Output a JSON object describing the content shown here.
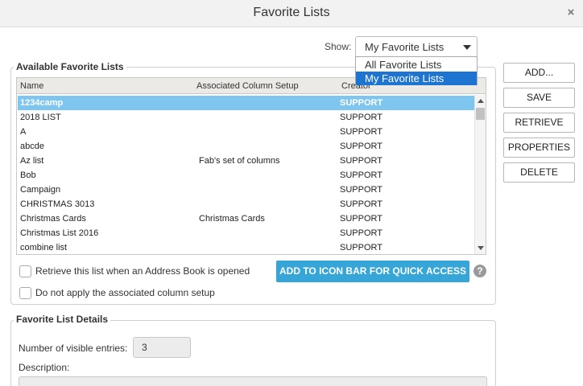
{
  "window": {
    "title": "Favorite Lists",
    "close_glyph": "×"
  },
  "show": {
    "label": "Show:",
    "selected": "My Favorite Lists",
    "options": [
      "All Favorite Lists",
      "My Favorite Lists"
    ]
  },
  "available": {
    "legend": "Available Favorite Lists",
    "columns": [
      "Name",
      "Associated Column Setup",
      "Creator"
    ],
    "rows": [
      {
        "name": "1234camp",
        "setup": "",
        "creator": "SUPPORT",
        "selected": true
      },
      {
        "name": "2018 LIST",
        "setup": "",
        "creator": "SUPPORT"
      },
      {
        "name": "A",
        "setup": "",
        "creator": "SUPPORT"
      },
      {
        "name": "abcde",
        "setup": "",
        "creator": "SUPPORT"
      },
      {
        "name": "Az list",
        "setup": "Fab's set of columns",
        "creator": "SUPPORT"
      },
      {
        "name": "Bob",
        "setup": "",
        "creator": "SUPPORT"
      },
      {
        "name": "Campaign",
        "setup": "",
        "creator": "SUPPORT"
      },
      {
        "name": "CHRISTMAS 3013",
        "setup": "",
        "creator": "SUPPORT"
      },
      {
        "name": "Christmas Cards",
        "setup": "Christmas Cards",
        "creator": "SUPPORT"
      },
      {
        "name": "Christmas List 2016",
        "setup": "",
        "creator": "SUPPORT"
      },
      {
        "name": "combine list",
        "setup": "",
        "creator": "SUPPORT"
      }
    ],
    "retrieve_label": "Retrieve this list when an Address Book is opened",
    "no_apply_label": "Do not apply the associated column setup",
    "add_icon_bar_label": "ADD TO ICON BAR FOR QUICK ACCESS",
    "help_glyph": "?"
  },
  "actions": {
    "add": "ADD...",
    "save": "SAVE",
    "retrieve": "RETRIEVE",
    "properties": "PROPERTIES",
    "delete": "DELETE"
  },
  "details": {
    "legend": "Favorite List Details",
    "visible_entries_label": "Number of visible entries:",
    "visible_entries_value": "3",
    "description_label": "Description:"
  },
  "colors": {
    "accent": "#36a5d8",
    "selection": "#7ec6ef",
    "dropdown_highlight": "#1e74d1"
  }
}
